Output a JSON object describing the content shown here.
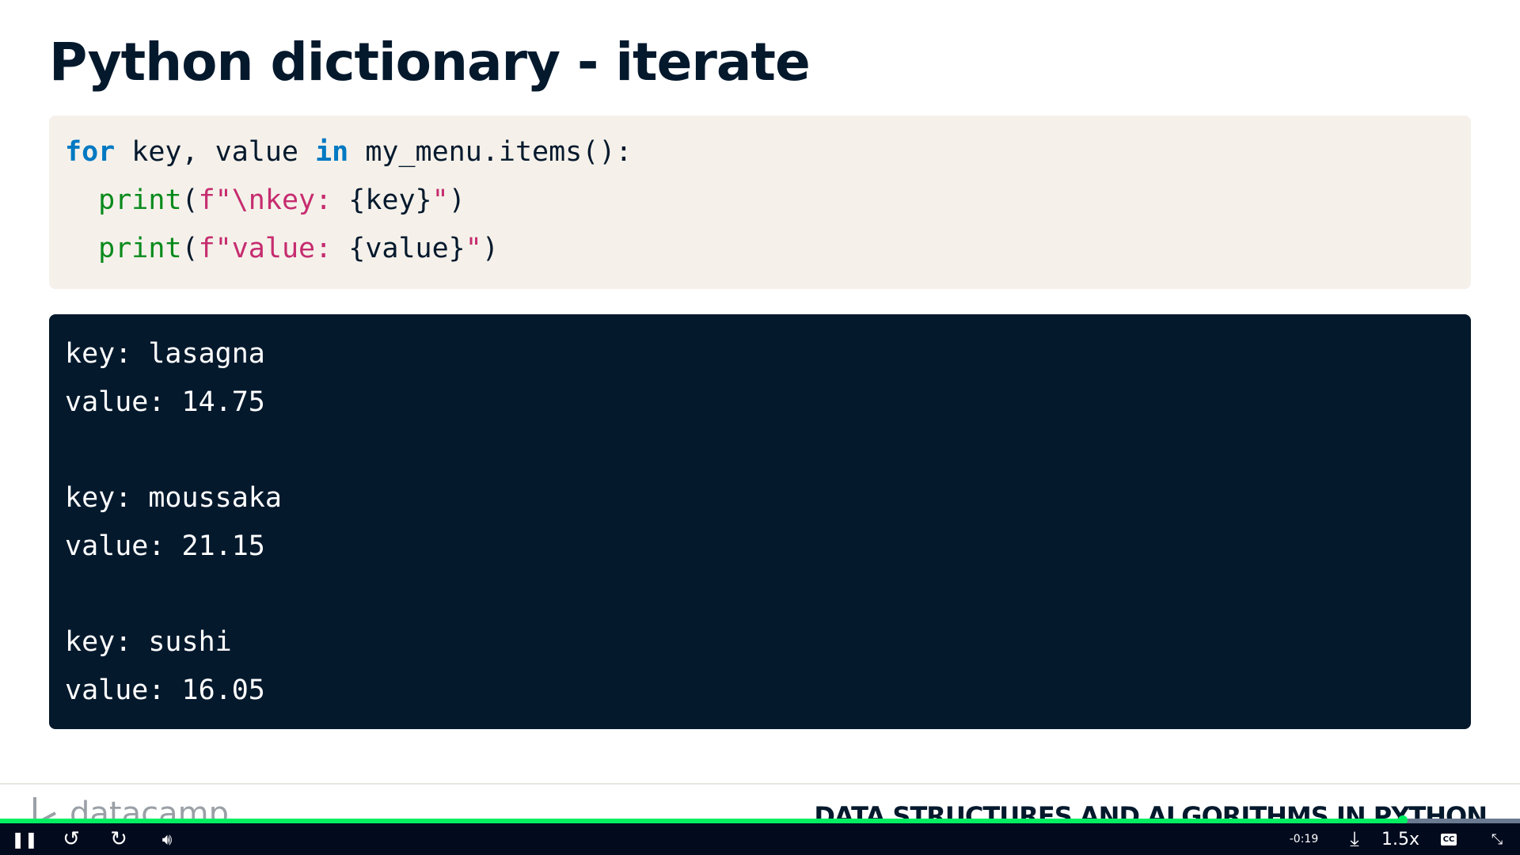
{
  "slide": {
    "title": "Python dictionary - iterate"
  },
  "code": {
    "lines": [
      [
        {
          "t": "for",
          "c": "kw"
        },
        {
          "t": " key, value ",
          "c": ""
        },
        {
          "t": "in",
          "c": "kw"
        },
        {
          "t": " my_menu.items():",
          "c": ""
        }
      ],
      [
        {
          "t": "  ",
          "c": ""
        },
        {
          "t": "print",
          "c": "fn"
        },
        {
          "t": "(",
          "c": ""
        },
        {
          "t": "f\"\\nkey: ",
          "c": "st"
        },
        {
          "t": "{key}",
          "c": ""
        },
        {
          "t": "\"",
          "c": "st"
        },
        {
          "t": ")",
          "c": ""
        }
      ],
      [
        {
          "t": "  ",
          "c": ""
        },
        {
          "t": "print",
          "c": "fn"
        },
        {
          "t": "(",
          "c": ""
        },
        {
          "t": "f\"value: ",
          "c": "st"
        },
        {
          "t": "{value}",
          "c": ""
        },
        {
          "t": "\"",
          "c": "st"
        },
        {
          "t": ")",
          "c": ""
        }
      ]
    ]
  },
  "output": {
    "lines": [
      "key: lasagna",
      "value: 14.75",
      "",
      "key: moussaka",
      "value: 21.15",
      "",
      "key: sushi",
      "value: 16.05"
    ]
  },
  "footer": {
    "logo": "datacamp",
    "course": "DATA STRUCTURES AND ALGORITHMS IN PYTHON"
  },
  "player": {
    "time_remaining": "-0:19",
    "speed": "1.5x",
    "progress_percent": 92.3,
    "skip_back": "10",
    "skip_forward": "10",
    "icons": [
      "pause-icon",
      "rewind-10-icon",
      "forward-10-icon",
      "volume-icon",
      "download-icon",
      "captions-icon",
      "exit-fullscreen-icon"
    ]
  },
  "colors": {
    "keyword": "#0079c2",
    "function": "#098a1c",
    "string": "#c62c6f",
    "progress": "#03ef62"
  }
}
